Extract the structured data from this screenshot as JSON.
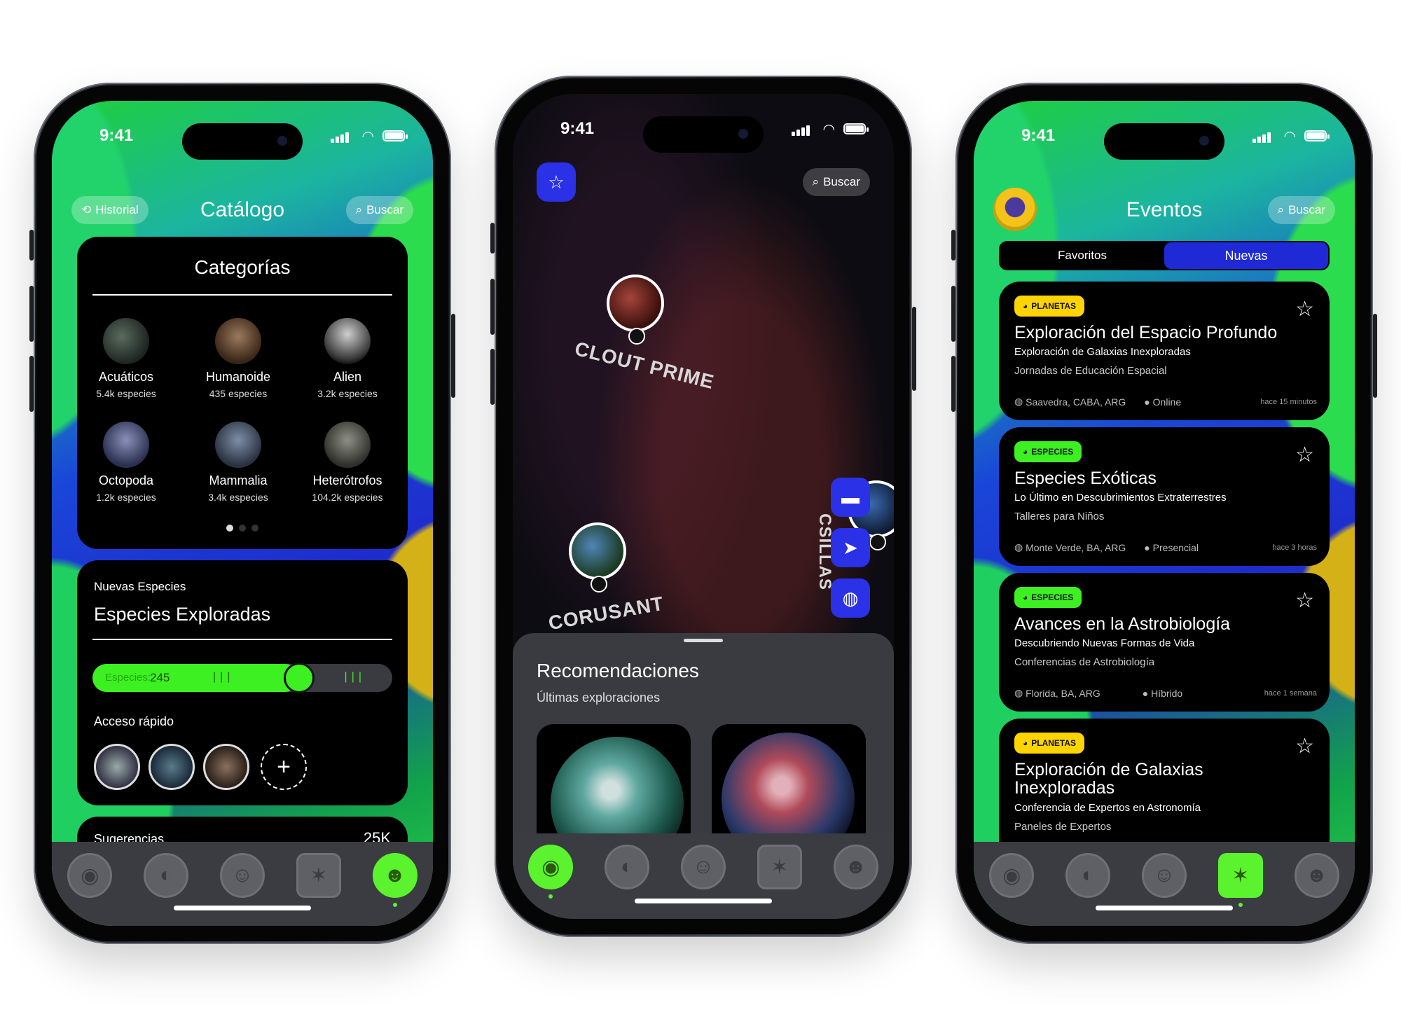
{
  "status": {
    "time": "9:41"
  },
  "phone1": {
    "history_label": "Historial",
    "search_label": "Buscar",
    "title": "Catálogo",
    "categories_title": "Categorías",
    "categories": [
      {
        "name": "Acuáticos",
        "count": "5.4k especies"
      },
      {
        "name": "Humanoide",
        "count": "435 especies"
      },
      {
        "name": "Alien",
        "count": "3.2k especies"
      },
      {
        "name": "Octopoda",
        "count": "1.2k especies"
      },
      {
        "name": "Mammalia",
        "count": "3.4k especies"
      },
      {
        "name": "Heterótrofos",
        "count": "104.2k especies"
      }
    ],
    "new_species": {
      "subtitle": "Nuevas Especies",
      "title": "Especies Exploradas",
      "slider_prefix": "Especies:",
      "slider_value": "245",
      "slider_fraction": 0.69,
      "quick_access": "Acceso rápido",
      "add_symbol": "+"
    },
    "suggestions": {
      "label": "Sugerencias",
      "value": "25K"
    }
  },
  "phone2": {
    "search_label": "Buscar",
    "planets": [
      "CLOUT PRIME",
      "CORUSANT",
      "CSILLAS"
    ],
    "recommendations_title": "Recomendaciones",
    "recommendations_subtitle": "Últimas exploraciones"
  },
  "phone3": {
    "title": "Eventos",
    "search_label": "Buscar",
    "tabs": [
      "Favoritos",
      "Nuevas"
    ],
    "events": [
      {
        "badge": "PLANETAS",
        "title": "Exploración del Espacio Profundo",
        "subtitle": "Exploración de Galaxias Inexploradas",
        "detail": "Jornadas de Educación Espacial",
        "location": "Saavedra, CABA, ARG",
        "mode": "Online",
        "ago": "hace 15 minutos"
      },
      {
        "badge": "ESPECIES",
        "title": "Especies Exóticas",
        "subtitle": "Lo Último en Descubrimientos Extraterrestres",
        "detail": "Talleres para Niños",
        "location": "Monte Verde, BA, ARG",
        "mode": "Presencial",
        "ago": "hace 3 horas"
      },
      {
        "badge": "ESPECIES",
        "title": "Avances en la Astrobiología",
        "subtitle": "Descubriendo Nuevas Formas de Vida",
        "detail": "Conferencias de Astrobiología",
        "location": "Florida, BA, ARG",
        "mode": "Híbrido",
        "ago": "hace 1 semana"
      },
      {
        "badge": "PLANETAS",
        "title": "Exploración de Galaxias Inexploradas",
        "subtitle": "Conferencia de Expertos en Astronomía",
        "detail": "Paneles de Expertos",
        "location": "",
        "mode": "",
        "ago": ""
      }
    ]
  },
  "colors": {
    "accent_green": "#5bf22e",
    "accent_blue": "#2a31e6",
    "badge_yellow": "#ffd400",
    "badge_green": "#3cf021"
  },
  "icons": [
    "eye-icon",
    "alien-planet-icon",
    "astronaut-icon",
    "calendar-icon",
    "alien-face-icon",
    "star-icon",
    "search-icon",
    "history-icon",
    "globe-icon",
    "person-icon",
    "send-icon",
    "vr-headset-icon"
  ]
}
